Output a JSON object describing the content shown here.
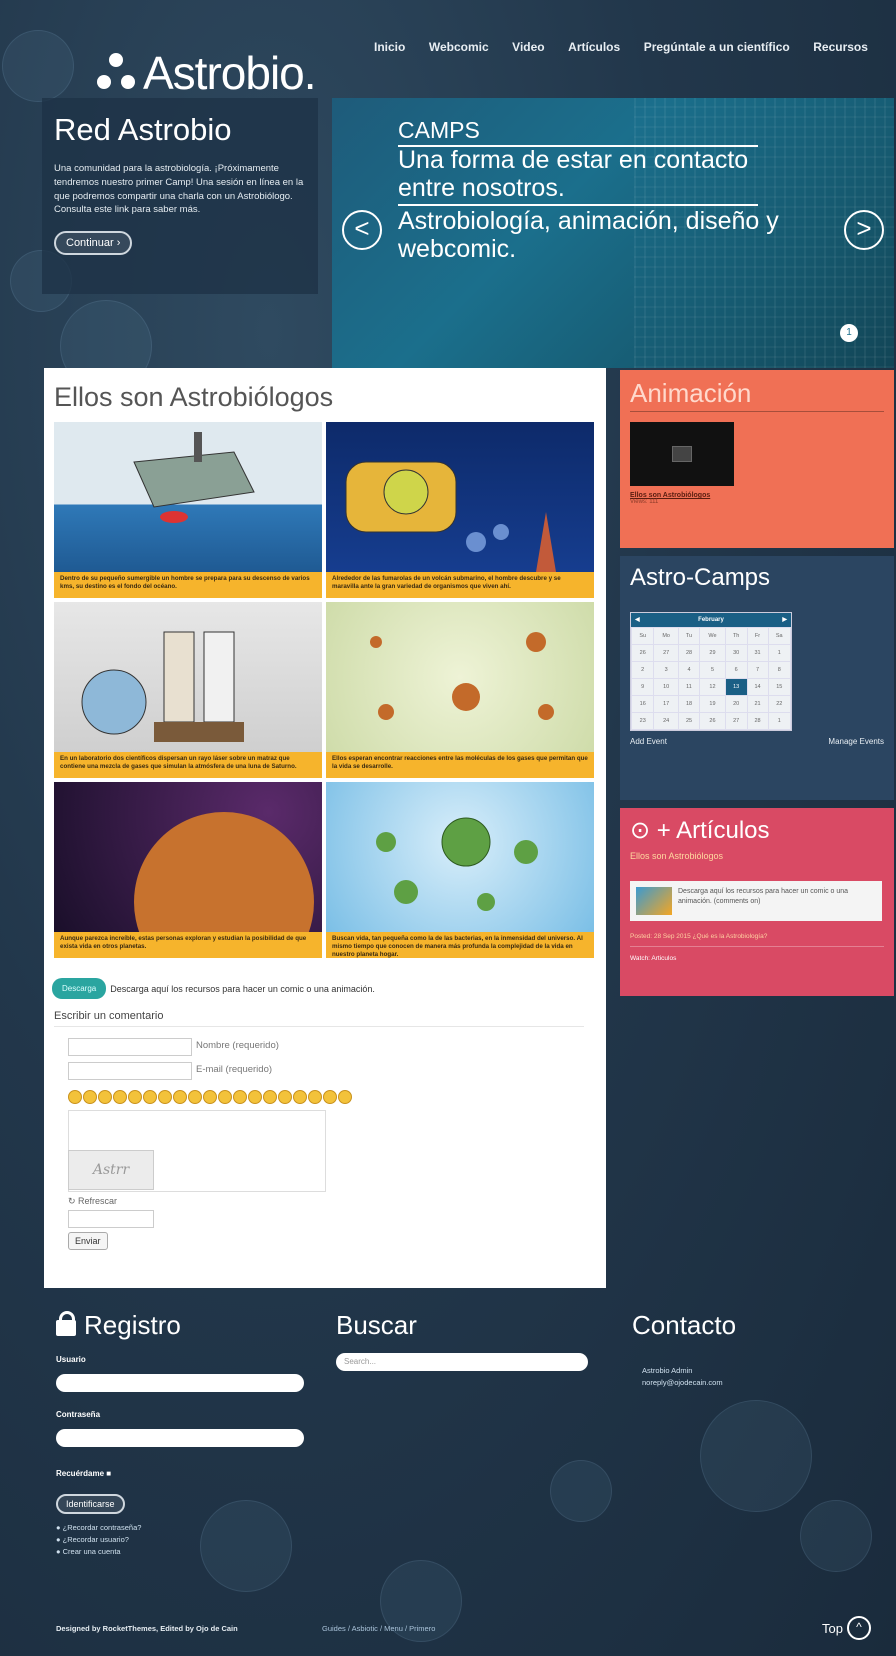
{
  "logo": {
    "text": "Astrobio."
  },
  "nav": [
    "Inicio",
    "Webcomic",
    "Video",
    "Artículos",
    "Pregúntale a un científico",
    "Recursos"
  ],
  "intro": {
    "title": "Red Astrobio",
    "body": "Una comunidad para la astrobiología. ¡Próximamente tendremos nuestro primer Camp! Una sesión en línea en la que podremos compartir una charla con un Astrobiólogo. Consulta este link para saber más.",
    "button": "Continuar"
  },
  "hero": {
    "line1": "CAMPS",
    "line2": "Una forma de estar en contacto entre nosotros.",
    "line3": "Astrobiología, animación, diseño y webcomic.",
    "prev": "<",
    "next": ">",
    "slide": "1"
  },
  "main": {
    "title": "Ellos son Astrobiólogos",
    "captions": [
      "Dentro de su pequeño sumergible un hombre se prepara para su descenso de varios kms, su destino es el fondo del océano.",
      "Alrededor de las fumarolas de un volcán submarino, el hombre descubre y se maravilla ante la gran variedad de organismos que viven ahí.",
      "En un laboratorio dos científicos dispersan un rayo láser sobre un matraz que contiene una mezcla de gases que simulan la atmósfera de una luna de Saturno.",
      "Ellos esperan encontrar reacciones entre las moléculas de los gases que permitan que la vida se desarrolle.",
      "Aunque parezca increíble, estas personas exploran y estudian la posibilidad de que exista vida en otros planetas.",
      "Buscan vida, tan pequeña como la de las bacterias, en la inmensidad del universo. Al mismo tiempo que conocen de manera más profunda la complejidad de la vida en nuestro planeta hogar."
    ],
    "download_chip": "Descarga",
    "download_text": "Descarga aquí los recursos para hacer un comic o una animación.",
    "comment_heading": "Escribir un comentario",
    "name_label": "Nombre (requerido)",
    "email_label": "E-mail (requerido)",
    "captcha_text": "Astrr",
    "refresh": "↻ Refrescar",
    "send": "Enviar"
  },
  "sidebar": {
    "animacion": {
      "title": "Animación",
      "video_title": "Ellos son Astrobiólogos",
      "video_sub": "Views: 111"
    },
    "camps": {
      "title": "Astro-Camps",
      "month": "February",
      "weekdays": [
        "Su",
        "Mo",
        "Tu",
        "We",
        "Th",
        "Fr",
        "Sa"
      ],
      "weeks": [
        [
          "26",
          "27",
          "28",
          "29",
          "30",
          "31",
          "1"
        ],
        [
          "2",
          "3",
          "4",
          "5",
          "6",
          "7",
          "8"
        ],
        [
          "9",
          "10",
          "11",
          "12",
          "13",
          "14",
          "15"
        ],
        [
          "16",
          "17",
          "18",
          "19",
          "20",
          "21",
          "22"
        ],
        [
          "23",
          "24",
          "25",
          "26",
          "27",
          "28",
          "1"
        ]
      ],
      "today": "13",
      "add_event": "Add Event",
      "manage_events": "Manage Events"
    },
    "articulos": {
      "title": "+ Artículos",
      "link": "Ellos son Astrobiólogos",
      "box": "Descarga aquí los recursos para hacer un comic o una animación. (comments on)",
      "meta": "Posted: 28 Sep 2015 ¿Qué es la Astrobiología?",
      "foot": "Watch: Articulos"
    }
  },
  "footer": {
    "registro": {
      "title": "Registro",
      "user": "Usuario",
      "pass": "Contraseña",
      "remember": "Recuérdame",
      "login": "Identificarse",
      "links": [
        "¿Recordar contraseña?",
        "¿Recordar usuario?",
        "Crear una cuenta"
      ]
    },
    "buscar": {
      "title": "Buscar",
      "placeholder": "Search..."
    },
    "contacto": {
      "title": "Contacto",
      "name": "Astrobio Admin",
      "email": "noreply@ojodecain.com"
    },
    "credits": "Designed by RocketThemes, Edited by Ojo de Cain",
    "links": "Guides / Asbiotic / Menu / Primero",
    "top": "Top"
  },
  "colors": {
    "accent_orange": "#f07055",
    "accent_pink": "#d94a64",
    "panel_blue": "#2b4561",
    "caption_yellow": "#f6b42c"
  }
}
